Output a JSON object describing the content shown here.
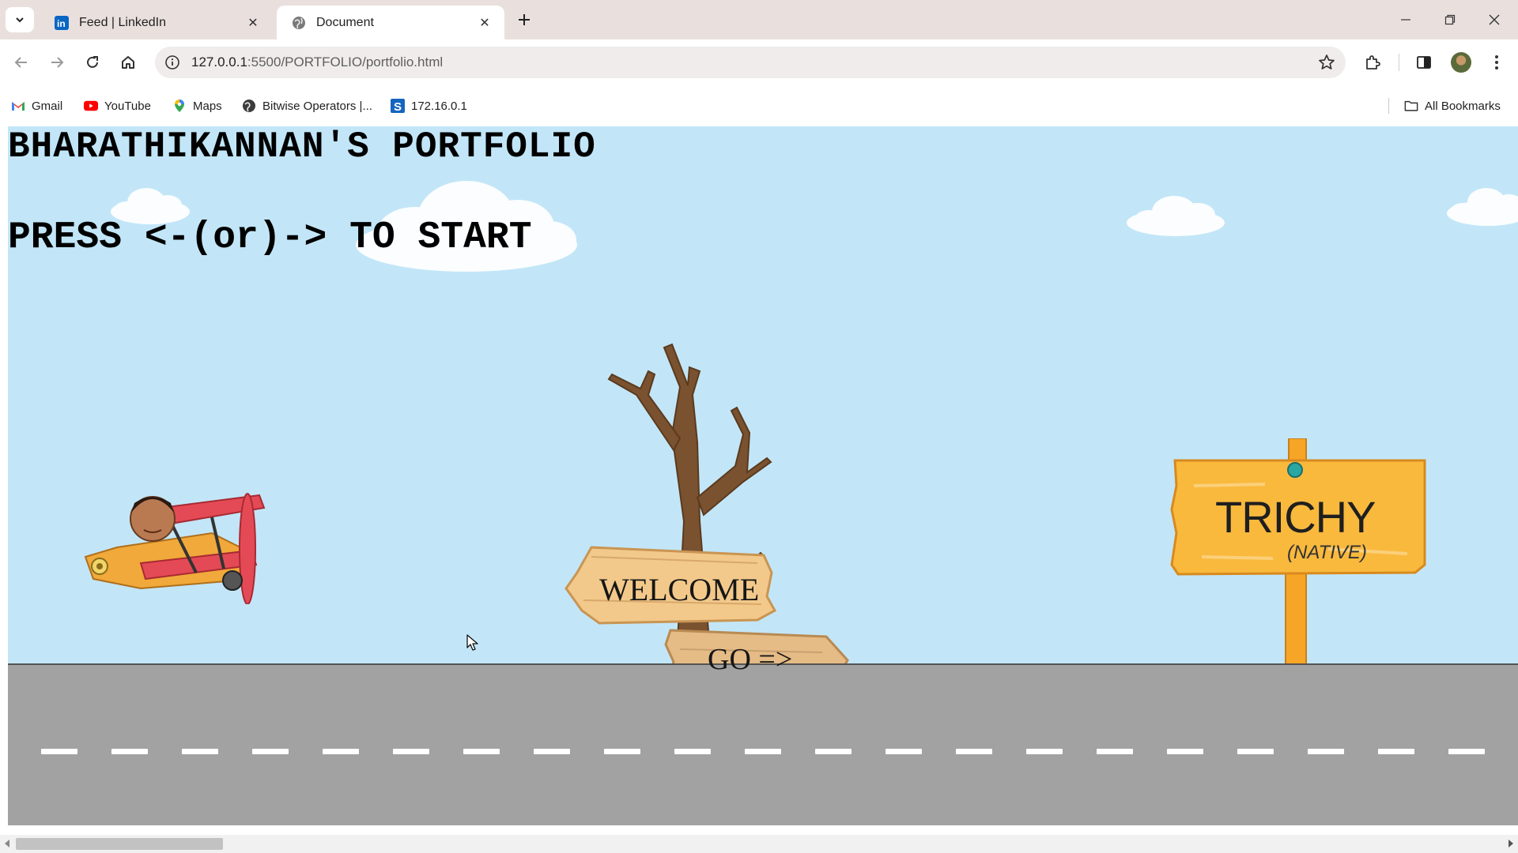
{
  "browser": {
    "tabs": [
      {
        "title": "Feed | LinkedIn",
        "icon": "linkedin-icon",
        "active": false
      },
      {
        "title": "Document",
        "icon": "globe-icon",
        "active": true
      }
    ],
    "url_host": "127.0.0.1",
    "url_path": ":5500/PORTFOLIO/portfolio.html",
    "bookmarks": [
      {
        "label": "Gmail",
        "icon": "gmail-icon"
      },
      {
        "label": "YouTube",
        "icon": "youtube-icon"
      },
      {
        "label": "Maps",
        "icon": "maps-icon"
      },
      {
        "label": "Bitwise Operators |...",
        "icon": "globe-icon"
      },
      {
        "label": "172.16.0.1",
        "icon": "s-icon"
      }
    ],
    "all_bookmarks_label": "All Bookmarks"
  },
  "page": {
    "title": "BHARATHIKANNAN'S PORTFOLIO",
    "instruction": "PRESS <-(or)-> TO START",
    "signpost": {
      "welcome": "WELCOME",
      "go": "GO =>"
    },
    "trichy_sign": {
      "name": "TRICHY",
      "note": "(NATIVE)"
    }
  },
  "colors": {
    "sky": "#c2e6f8",
    "road": "#a2a2a2",
    "sign_wood": "#f0c47a",
    "trichy_board": "#f8b73a"
  }
}
